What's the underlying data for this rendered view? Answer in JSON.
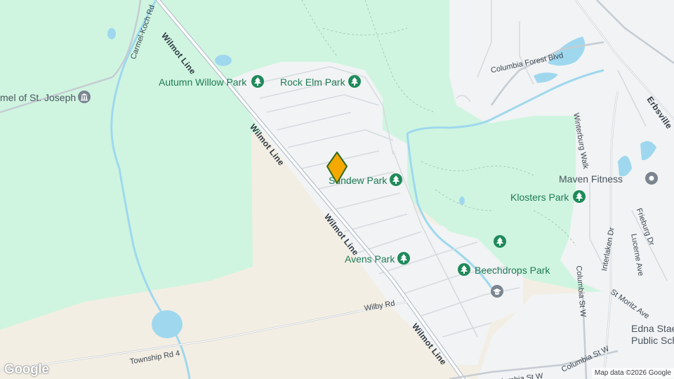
{
  "map": {
    "parks": [
      {
        "id": "autumn-willow",
        "label": "Autumn Willow Park"
      },
      {
        "id": "rock-elm",
        "label": "Rock Elm Park"
      },
      {
        "id": "sundew",
        "label": "Sundew Park"
      },
      {
        "id": "klosters",
        "label": "Klosters Park"
      },
      {
        "id": "avens",
        "label": "Avens Park"
      },
      {
        "id": "beechdrops",
        "label": "Beechdrops Park"
      }
    ],
    "places": {
      "carmel": "mel of St. Joseph",
      "maven": "Maven Fitness",
      "edna_line1": "Edna Stae",
      "edna_line2": "Public Sch"
    },
    "roads": {
      "wilmot_1": "Wilmot Line",
      "wilmot_2": "Wilmot Line",
      "wilmot_3": "Wilmot Line",
      "wilmot_4": "Wilmot Line",
      "carmel_koch": "Carmel-Koch Rd",
      "wilby": "Wilby Rd",
      "township4": "Township Rd 4",
      "columbia_forest": "Columbia Forest Blvd",
      "erbsville": "Erbsville",
      "winterburg": "Winterburg Walk",
      "interlaken": "Interlaken Dr",
      "lucerne": "Lucerne Ave",
      "frieburg": "Frieburg Dr",
      "columbia_st_w_1": "Columbia St W",
      "columbia_st_w_2": "Columbia St W",
      "columbia_st_w_3": "Columbia St W",
      "st_moritz": "St Moritz Ave"
    },
    "attribution": "Map data ©2026 Google",
    "logo": "Google"
  },
  "colors": {
    "forest": "#cff5e0",
    "urban": "#f1f3f4",
    "rural": "#f3eee3",
    "water": "#9fd8ee",
    "park_pin": "#1f8a5a",
    "marker": "#f5a800",
    "marker_outline": "#2e6b1e"
  },
  "icons": {
    "park": "tree-icon",
    "place": "landmark-icon",
    "school": "school-icon",
    "fitness": "place-icon",
    "marker": "location-diamond-icon"
  }
}
